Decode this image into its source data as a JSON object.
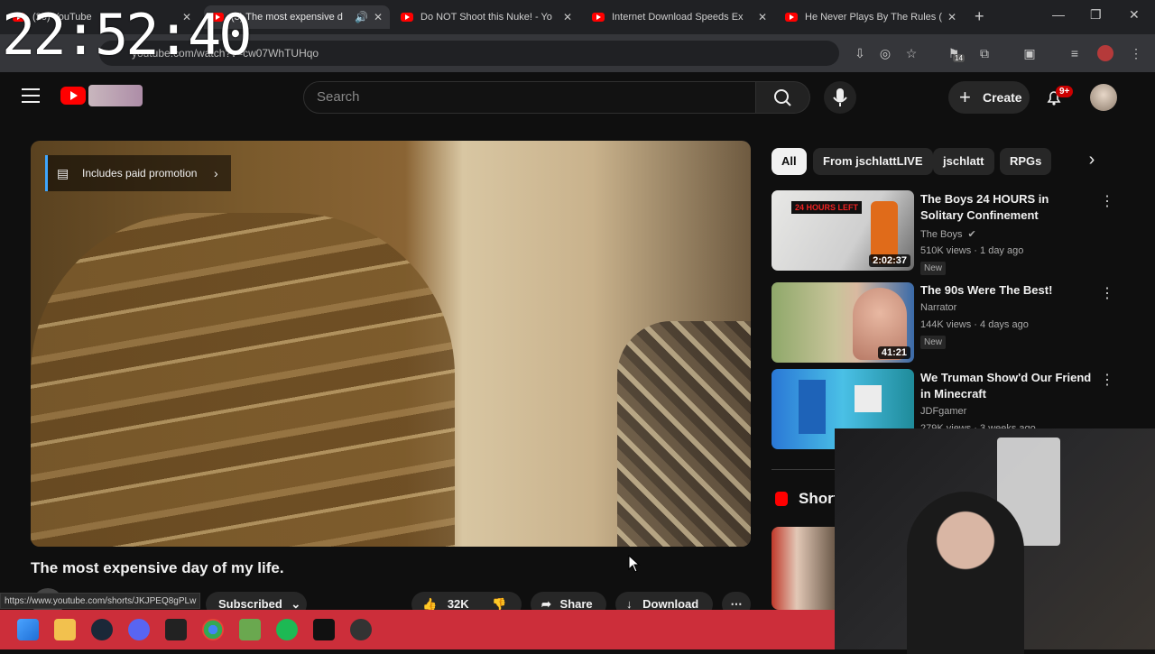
{
  "clock": "22:52:40",
  "browser": {
    "tabs": [
      {
        "label": "(26) YouTube"
      },
      {
        "label": "(3) The most expensive d"
      },
      {
        "label": "Do NOT Shoot this Nuke! - Yo"
      },
      {
        "label": "Internet Download Speeds Ex"
      },
      {
        "label": "He Never Plays By The Rules ("
      }
    ],
    "url": "youtube.com/watch?v=cw07WhTUHqo",
    "ext_badge": "14"
  },
  "youtube": {
    "search_placeholder": "Search",
    "create_label": "Create",
    "notif_count": "9+",
    "promo_label": "Includes paid promotion",
    "video_title": "The most expensive day of my life.",
    "subscribed_label": "Subscribed",
    "like_count": "32K",
    "share_label": "Share",
    "download_label": "Download",
    "chips": [
      "All",
      "From jschlattLIVE",
      "jschlatt",
      "RPGs"
    ],
    "shorts_label": "Shorts",
    "recommendations": [
      {
        "title": "The Boys 24 HOURS in Solitary Confinement",
        "channel": "The Boys",
        "meta": "510K views · 1 day ago",
        "duration": "2:02:37",
        "badge": "New",
        "thumb_text": "24 HOURS LEFT"
      },
      {
        "title": "The 90s Were The Best!",
        "channel": "Narrator",
        "meta": "144K views · 4 days ago",
        "duration": "41:21",
        "badge": "New"
      },
      {
        "title": "We Truman Show'd Our Friend in Minecraft",
        "channel": "JDFgamer",
        "meta": "279K views · 3 weeks ago",
        "duration": "",
        "badge": ""
      }
    ]
  },
  "status_url": "https://www.youtube.com/shorts/JKJPEQ8gPLw",
  "colors": {
    "accent": "#ff0000",
    "taskbar": "#cc2e3a",
    "link": "#3ea6ff"
  }
}
